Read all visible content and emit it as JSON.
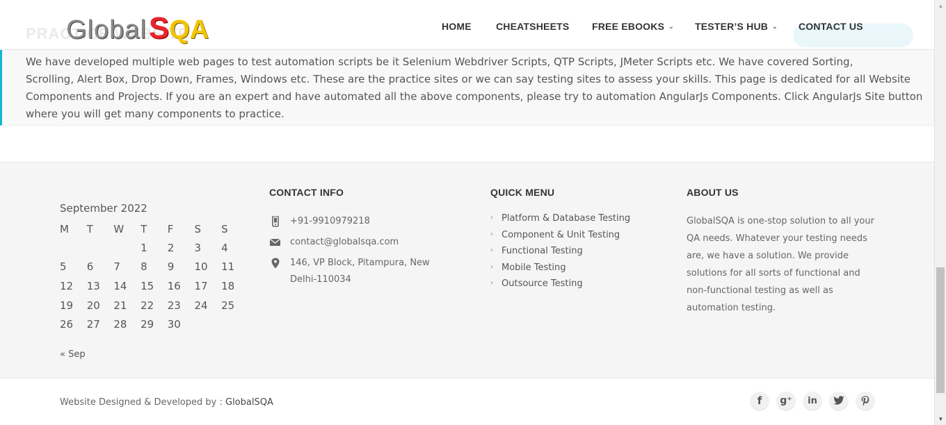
{
  "header": {
    "logo": {
      "global": "Global",
      "s": "S",
      "qa": "QA"
    },
    "ghost_title": "PRACTICE WEBSITE",
    "nav": [
      {
        "label": "HOME",
        "caret": false
      },
      {
        "label": "CHEATSHEETS",
        "caret": false
      },
      {
        "label": "FREE EBOOKS",
        "caret": true
      },
      {
        "label": "TESTER’S HUB",
        "caret": true
      },
      {
        "label": "CONTACT US",
        "caret": false
      }
    ]
  },
  "practice": {
    "text": "We have developed multiple web pages to test automation scripts be it Selenium Webdriver Scripts, QTP Scripts, JMeter Scripts etc. We have covered Sorting,",
    "text2": "Scrolling, Alert Box, Drop Down, Frames, Windows etc. These are the practice sites or we can say testing sites to assess your skills. This page is dedicated for all Website Components and Projects. If you are an expert and have automated all the above components, please try to automation AngularJs Components. Click AngularJs Site button where you will get many components to practice."
  },
  "calendar": {
    "caption": "September 2022",
    "weekdays": [
      "M",
      "T",
      "W",
      "T",
      "F",
      "S",
      "S"
    ],
    "weeks": [
      [
        "",
        "",
        "",
        "1",
        "2",
        "3",
        "4"
      ],
      [
        "5",
        "6",
        "7",
        "8",
        "9",
        "10",
        "11"
      ],
      [
        "12",
        "13",
        "14",
        "15",
        "16",
        "17",
        "18"
      ],
      [
        "19",
        "20",
        "21",
        "22",
        "23",
        "24",
        "25"
      ],
      [
        "26",
        "27",
        "28",
        "29",
        "30",
        "",
        ""
      ]
    ],
    "prev": "« Sep"
  },
  "contact_info": {
    "title": "CONTACT INFO",
    "phone": "+91-9910979218",
    "email": "contact@globalsqa.com",
    "address": "146, VP Block, Pitampura, New Delhi-110034"
  },
  "quick_menu": {
    "title": "QUICK MENU",
    "items": [
      "Platform & Database Testing",
      "Component & Unit Testing",
      "Functional Testing",
      "Mobile Testing",
      "Outsource Testing"
    ]
  },
  "about": {
    "title": "ABOUT US",
    "text": "GlobalSQA is one-stop solution to all your QA needs. Whatever your testing needs are, we have a solution. We provide solutions for all sorts of functional and non-functional testing as well as automation testing."
  },
  "bottom": {
    "credit_prefix": "Website Designed & Developed by : ",
    "credit_brand": "GlobalSQA",
    "social": [
      {
        "icon": "facebook-icon",
        "glyph": "f"
      },
      {
        "icon": "google-plus-icon",
        "glyph": "g⁺"
      },
      {
        "icon": "linkedin-icon",
        "glyph": "in"
      },
      {
        "icon": "twitter-icon",
        "glyph": "🐦"
      },
      {
        "icon": "pinterest-icon",
        "glyph": "P"
      }
    ]
  },
  "colors": {
    "accent": "#10b6d3",
    "logo_red": "#e8262b",
    "logo_yellow": "#f2c500"
  }
}
